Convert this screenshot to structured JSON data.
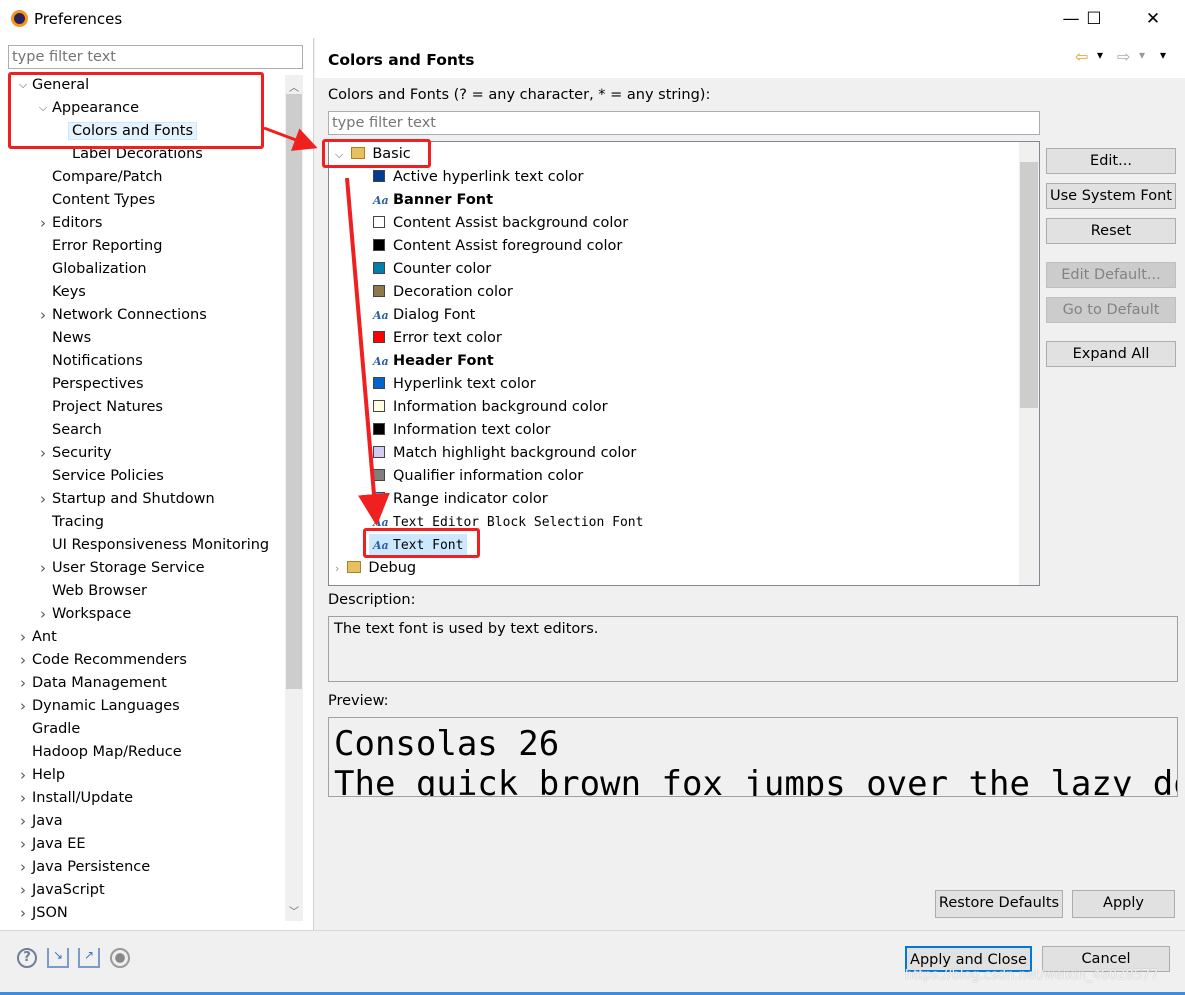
{
  "window": {
    "title": "Preferences",
    "minimize": "—",
    "maximize": "☐",
    "close": "✕"
  },
  "left": {
    "filter_placeholder": "type filter text",
    "tree": [
      {
        "label": "General",
        "level": 0,
        "state": "expanded"
      },
      {
        "label": "Appearance",
        "level": 1,
        "state": "expanded"
      },
      {
        "label": "Colors and Fonts",
        "level": 2,
        "state": "leaf",
        "selected": true
      },
      {
        "label": "Label Decorations",
        "level": 2,
        "state": "leaf"
      },
      {
        "label": "Compare/Patch",
        "level": 1,
        "state": "leaf"
      },
      {
        "label": "Content Types",
        "level": 1,
        "state": "leaf"
      },
      {
        "label": "Editors",
        "level": 1,
        "state": "collapsed"
      },
      {
        "label": "Error Reporting",
        "level": 1,
        "state": "leaf"
      },
      {
        "label": "Globalization",
        "level": 1,
        "state": "leaf"
      },
      {
        "label": "Keys",
        "level": 1,
        "state": "leaf"
      },
      {
        "label": "Network Connections",
        "level": 1,
        "state": "collapsed"
      },
      {
        "label": "News",
        "level": 1,
        "state": "leaf"
      },
      {
        "label": "Notifications",
        "level": 1,
        "state": "leaf"
      },
      {
        "label": "Perspectives",
        "level": 1,
        "state": "leaf"
      },
      {
        "label": "Project Natures",
        "level": 1,
        "state": "leaf"
      },
      {
        "label": "Search",
        "level": 1,
        "state": "leaf"
      },
      {
        "label": "Security",
        "level": 1,
        "state": "collapsed"
      },
      {
        "label": "Service Policies",
        "level": 1,
        "state": "leaf"
      },
      {
        "label": "Startup and Shutdown",
        "level": 1,
        "state": "collapsed"
      },
      {
        "label": "Tracing",
        "level": 1,
        "state": "leaf"
      },
      {
        "label": "UI Responsiveness Monitoring",
        "level": 1,
        "state": "leaf"
      },
      {
        "label": "User Storage Service",
        "level": 1,
        "state": "collapsed"
      },
      {
        "label": "Web Browser",
        "level": 1,
        "state": "leaf"
      },
      {
        "label": "Workspace",
        "level": 1,
        "state": "collapsed"
      },
      {
        "label": "Ant",
        "level": 0,
        "state": "collapsed"
      },
      {
        "label": "Code Recommenders",
        "level": 0,
        "state": "collapsed"
      },
      {
        "label": "Data Management",
        "level": 0,
        "state": "collapsed"
      },
      {
        "label": "Dynamic Languages",
        "level": 0,
        "state": "collapsed"
      },
      {
        "label": "Gradle",
        "level": 0,
        "state": "leaf"
      },
      {
        "label": "Hadoop Map/Reduce",
        "level": 0,
        "state": "leaf"
      },
      {
        "label": "Help",
        "level": 0,
        "state": "collapsed"
      },
      {
        "label": "Install/Update",
        "level": 0,
        "state": "collapsed"
      },
      {
        "label": "Java",
        "level": 0,
        "state": "collapsed"
      },
      {
        "label": "Java EE",
        "level": 0,
        "state": "collapsed"
      },
      {
        "label": "Java Persistence",
        "level": 0,
        "state": "collapsed"
      },
      {
        "label": "JavaScript",
        "level": 0,
        "state": "collapsed"
      },
      {
        "label": "JSON",
        "level": 0,
        "state": "collapsed"
      }
    ]
  },
  "right": {
    "title": "Colors and Fonts",
    "nav": {
      "back": "⇦",
      "forward": "⇨",
      "menu": "▾"
    },
    "filter_label": "Colors and Fonts (? = any character, * = any string):",
    "filter_placeholder": "type filter text",
    "category": "Basic",
    "items": [
      {
        "label": "Active hyperlink text color",
        "type": "color",
        "color": "#003c8f"
      },
      {
        "label": "Banner Font",
        "type": "font",
        "style": "bold"
      },
      {
        "label": "Content Assist background color",
        "type": "color",
        "color": "#ffffff"
      },
      {
        "label": "Content Assist foreground color",
        "type": "color",
        "color": "#000000"
      },
      {
        "label": "Counter color",
        "type": "color",
        "color": "#0080a8"
      },
      {
        "label": "Decoration color",
        "type": "color",
        "color": "#8c7a4a"
      },
      {
        "label": "Dialog Font",
        "type": "font",
        "style": "normal"
      },
      {
        "label": "Error text color",
        "type": "color",
        "color": "#ff0000"
      },
      {
        "label": "Header Font",
        "type": "font",
        "style": "bold"
      },
      {
        "label": "Hyperlink text color",
        "type": "color",
        "color": "#0066cc"
      },
      {
        "label": "Information background color",
        "type": "color",
        "color": "#ffffe1"
      },
      {
        "label": "Information text color",
        "type": "color",
        "color": "#000000"
      },
      {
        "label": "Match highlight background color",
        "type": "color",
        "color": "#d0ccf4"
      },
      {
        "label": "Qualifier information color",
        "type": "color",
        "color": "#808080"
      },
      {
        "label": "Range indicator color",
        "type": "color",
        "color": "#3f9fff"
      },
      {
        "label": "Text Editor Block Selection Font",
        "type": "font",
        "style": "mono"
      },
      {
        "label": "Text Font",
        "type": "font",
        "style": "mono",
        "selected": true
      }
    ],
    "next_category": "Debug",
    "buttons": {
      "edit": "Edit...",
      "use_system_font": "Use System Font",
      "reset": "Reset",
      "edit_default": "Edit Default...",
      "go_to_default": "Go to Default",
      "expand_all": "Expand All"
    },
    "description_label": "Description:",
    "description": "The text font is used by text editors.",
    "preview_label": "Preview:",
    "preview_line1": "Consolas 26",
    "preview_line2": "The quick brown fox jumps over the lazy dog.",
    "restore_defaults": "Restore Defaults",
    "apply": "Apply"
  },
  "footer": {
    "apply_and_close": "Apply and Close",
    "cancel": "Cancel",
    "icons": [
      "help-icon",
      "import-icon",
      "export-icon",
      "record-icon"
    ]
  },
  "watermark": "https://blog.csdn.net/weixin_46028577",
  "colors": {
    "annotation": "#f02020",
    "selection": "#cce8ff"
  }
}
